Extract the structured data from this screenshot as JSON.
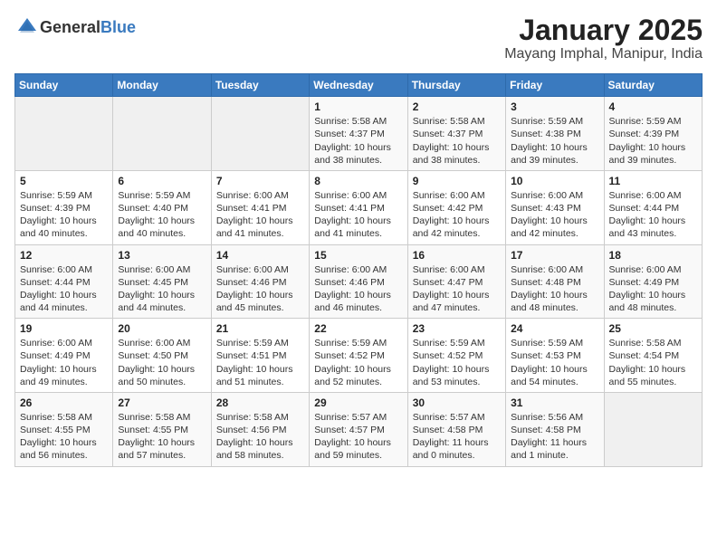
{
  "header": {
    "logo_general": "General",
    "logo_blue": "Blue",
    "month_title": "January 2025",
    "location": "Mayang Imphal, Manipur, India"
  },
  "weekdays": [
    "Sunday",
    "Monday",
    "Tuesday",
    "Wednesday",
    "Thursday",
    "Friday",
    "Saturday"
  ],
  "weeks": [
    [
      {
        "day": "",
        "info": ""
      },
      {
        "day": "",
        "info": ""
      },
      {
        "day": "",
        "info": ""
      },
      {
        "day": "1",
        "info": "Sunrise: 5:58 AM\nSunset: 4:37 PM\nDaylight: 10 hours\nand 38 minutes."
      },
      {
        "day": "2",
        "info": "Sunrise: 5:58 AM\nSunset: 4:37 PM\nDaylight: 10 hours\nand 38 minutes."
      },
      {
        "day": "3",
        "info": "Sunrise: 5:59 AM\nSunset: 4:38 PM\nDaylight: 10 hours\nand 39 minutes."
      },
      {
        "day": "4",
        "info": "Sunrise: 5:59 AM\nSunset: 4:39 PM\nDaylight: 10 hours\nand 39 minutes."
      }
    ],
    [
      {
        "day": "5",
        "info": "Sunrise: 5:59 AM\nSunset: 4:39 PM\nDaylight: 10 hours\nand 40 minutes."
      },
      {
        "day": "6",
        "info": "Sunrise: 5:59 AM\nSunset: 4:40 PM\nDaylight: 10 hours\nand 40 minutes."
      },
      {
        "day": "7",
        "info": "Sunrise: 6:00 AM\nSunset: 4:41 PM\nDaylight: 10 hours\nand 41 minutes."
      },
      {
        "day": "8",
        "info": "Sunrise: 6:00 AM\nSunset: 4:41 PM\nDaylight: 10 hours\nand 41 minutes."
      },
      {
        "day": "9",
        "info": "Sunrise: 6:00 AM\nSunset: 4:42 PM\nDaylight: 10 hours\nand 42 minutes."
      },
      {
        "day": "10",
        "info": "Sunrise: 6:00 AM\nSunset: 4:43 PM\nDaylight: 10 hours\nand 42 minutes."
      },
      {
        "day": "11",
        "info": "Sunrise: 6:00 AM\nSunset: 4:44 PM\nDaylight: 10 hours\nand 43 minutes."
      }
    ],
    [
      {
        "day": "12",
        "info": "Sunrise: 6:00 AM\nSunset: 4:44 PM\nDaylight: 10 hours\nand 44 minutes."
      },
      {
        "day": "13",
        "info": "Sunrise: 6:00 AM\nSunset: 4:45 PM\nDaylight: 10 hours\nand 44 minutes."
      },
      {
        "day": "14",
        "info": "Sunrise: 6:00 AM\nSunset: 4:46 PM\nDaylight: 10 hours\nand 45 minutes."
      },
      {
        "day": "15",
        "info": "Sunrise: 6:00 AM\nSunset: 4:46 PM\nDaylight: 10 hours\nand 46 minutes."
      },
      {
        "day": "16",
        "info": "Sunrise: 6:00 AM\nSunset: 4:47 PM\nDaylight: 10 hours\nand 47 minutes."
      },
      {
        "day": "17",
        "info": "Sunrise: 6:00 AM\nSunset: 4:48 PM\nDaylight: 10 hours\nand 48 minutes."
      },
      {
        "day": "18",
        "info": "Sunrise: 6:00 AM\nSunset: 4:49 PM\nDaylight: 10 hours\nand 48 minutes."
      }
    ],
    [
      {
        "day": "19",
        "info": "Sunrise: 6:00 AM\nSunset: 4:49 PM\nDaylight: 10 hours\nand 49 minutes."
      },
      {
        "day": "20",
        "info": "Sunrise: 6:00 AM\nSunset: 4:50 PM\nDaylight: 10 hours\nand 50 minutes."
      },
      {
        "day": "21",
        "info": "Sunrise: 5:59 AM\nSunset: 4:51 PM\nDaylight: 10 hours\nand 51 minutes."
      },
      {
        "day": "22",
        "info": "Sunrise: 5:59 AM\nSunset: 4:52 PM\nDaylight: 10 hours\nand 52 minutes."
      },
      {
        "day": "23",
        "info": "Sunrise: 5:59 AM\nSunset: 4:52 PM\nDaylight: 10 hours\nand 53 minutes."
      },
      {
        "day": "24",
        "info": "Sunrise: 5:59 AM\nSunset: 4:53 PM\nDaylight: 10 hours\nand 54 minutes."
      },
      {
        "day": "25",
        "info": "Sunrise: 5:58 AM\nSunset: 4:54 PM\nDaylight: 10 hours\nand 55 minutes."
      }
    ],
    [
      {
        "day": "26",
        "info": "Sunrise: 5:58 AM\nSunset: 4:55 PM\nDaylight: 10 hours\nand 56 minutes."
      },
      {
        "day": "27",
        "info": "Sunrise: 5:58 AM\nSunset: 4:55 PM\nDaylight: 10 hours\nand 57 minutes."
      },
      {
        "day": "28",
        "info": "Sunrise: 5:58 AM\nSunset: 4:56 PM\nDaylight: 10 hours\nand 58 minutes."
      },
      {
        "day": "29",
        "info": "Sunrise: 5:57 AM\nSunset: 4:57 PM\nDaylight: 10 hours\nand 59 minutes."
      },
      {
        "day": "30",
        "info": "Sunrise: 5:57 AM\nSunset: 4:58 PM\nDaylight: 11 hours\nand 0 minutes."
      },
      {
        "day": "31",
        "info": "Sunrise: 5:56 AM\nSunset: 4:58 PM\nDaylight: 11 hours\nand 1 minute."
      },
      {
        "day": "",
        "info": ""
      }
    ]
  ]
}
